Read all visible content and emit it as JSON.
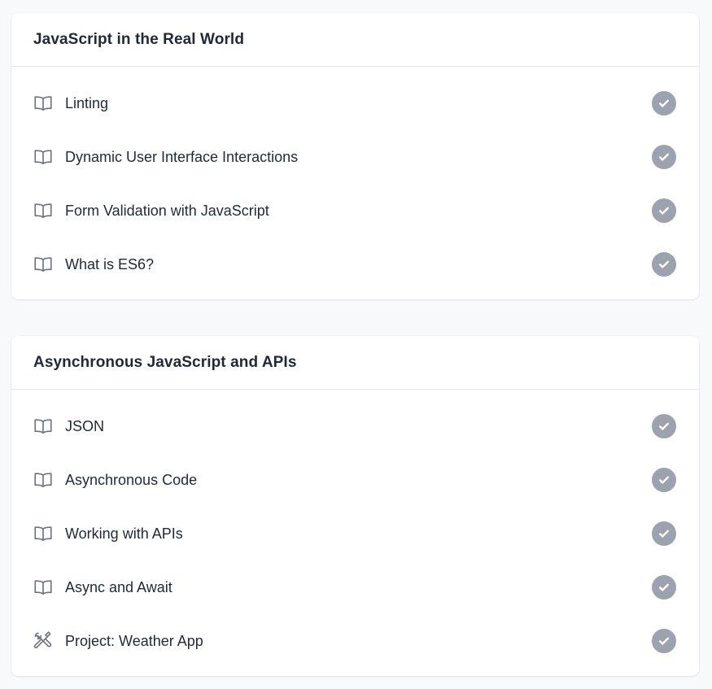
{
  "sections": [
    {
      "title": "JavaScript in the Real World",
      "lessons": [
        {
          "label": "Linting",
          "icon": "book-open-icon",
          "completed": true
        },
        {
          "label": "Dynamic User Interface Interactions",
          "icon": "book-open-icon",
          "completed": true
        },
        {
          "label": "Form Validation with JavaScript",
          "icon": "book-open-icon",
          "completed": true
        },
        {
          "label": "What is ES6?",
          "icon": "book-open-icon",
          "completed": true
        }
      ]
    },
    {
      "title": "Asynchronous JavaScript and APIs",
      "lessons": [
        {
          "label": "JSON",
          "icon": "book-open-icon",
          "completed": true
        },
        {
          "label": "Asynchronous Code",
          "icon": "book-open-icon",
          "completed": true
        },
        {
          "label": "Working with APIs",
          "icon": "book-open-icon",
          "completed": true
        },
        {
          "label": "Async and Await",
          "icon": "book-open-icon",
          "completed": true
        },
        {
          "label": "Project: Weather App",
          "icon": "wrench-screwdriver-icon",
          "completed": true
        }
      ]
    }
  ],
  "colors": {
    "background": "#f8f9fb",
    "card": "#ffffff",
    "check_completed": "#9ca3af",
    "icon": "#6b7280",
    "text": "#1f2937"
  }
}
